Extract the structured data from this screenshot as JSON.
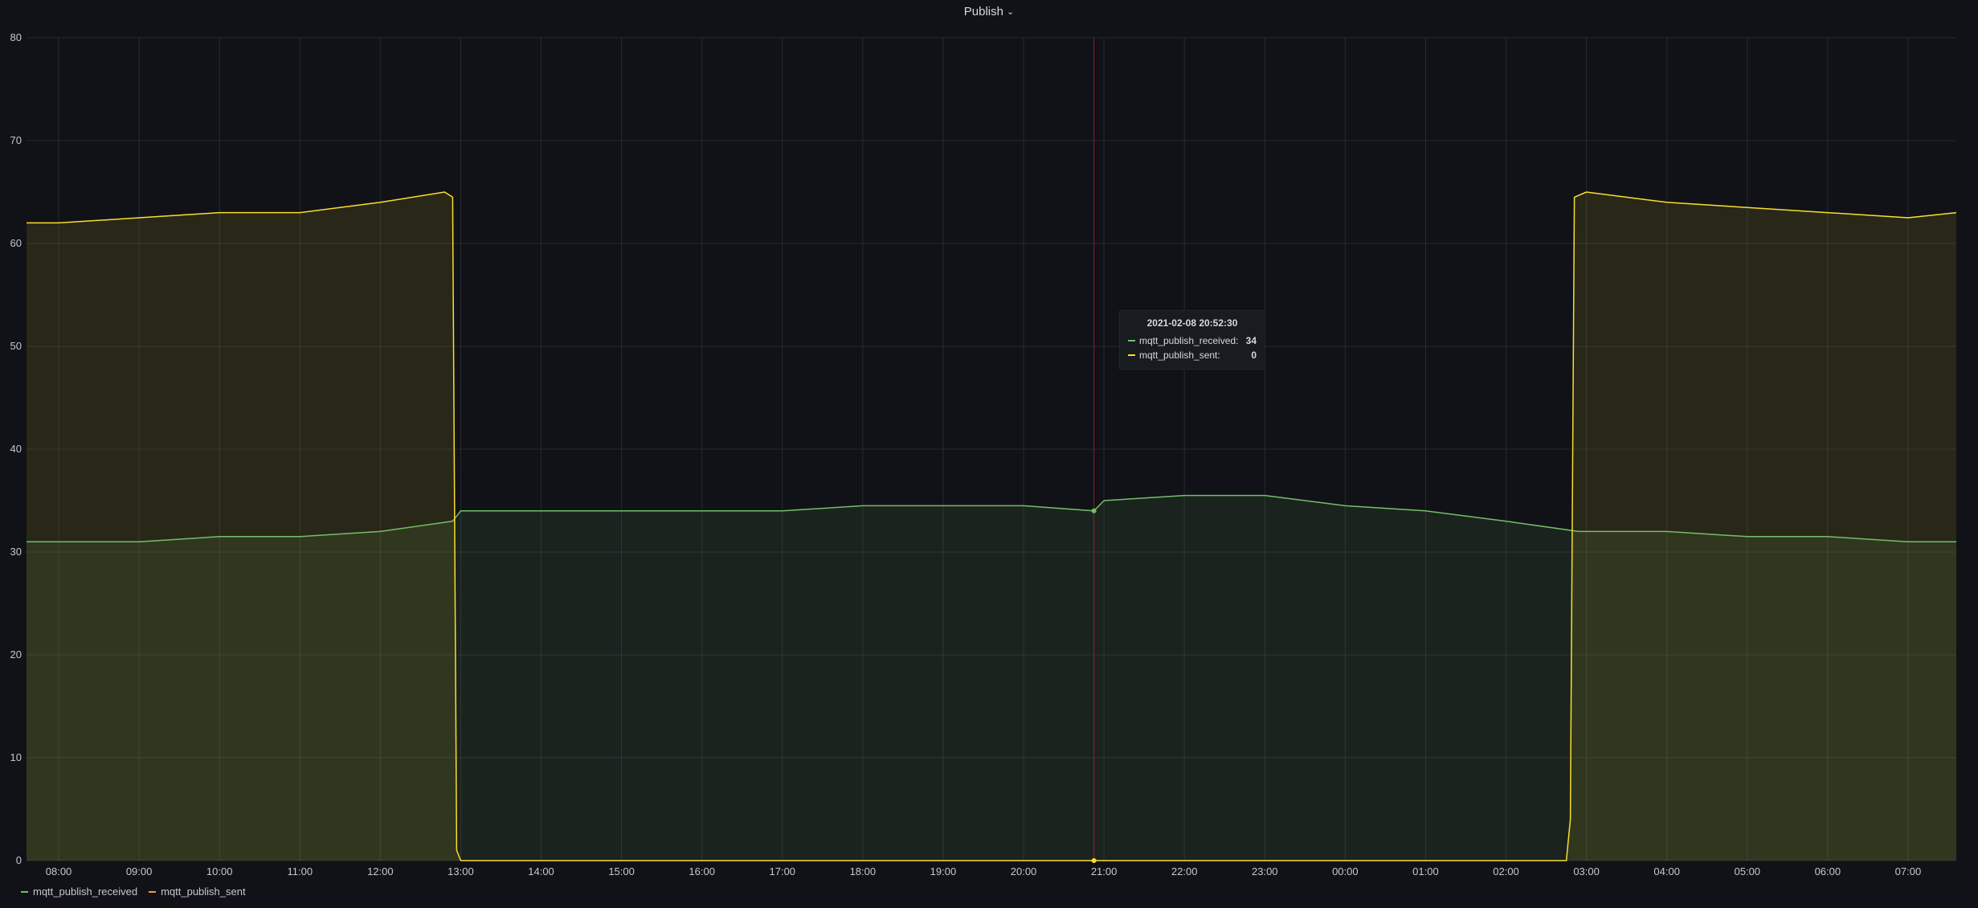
{
  "panel": {
    "title": "Publish"
  },
  "tooltip": {
    "time": "2021-02-08 20:52:30",
    "rows": [
      {
        "name": "mqtt_publish_received:",
        "value": "34",
        "color": "#73bf69"
      },
      {
        "name": "mqtt_publish_sent:",
        "value": "0",
        "color": "#fade2a"
      }
    ]
  },
  "legend": [
    {
      "name": "mqtt_publish_received",
      "color": "#73bf69"
    },
    {
      "name": "mqtt_publish_sent",
      "color": "#ff9830"
    }
  ],
  "chart_data": {
    "type": "area",
    "title": "Publish",
    "xlabel": "",
    "ylabel": "",
    "x_start": "2021-02-08 07:37",
    "x_end": "2021-02-09 07:37",
    "xlim_hours": [
      7.6,
      31.6
    ],
    "ylim": [
      0,
      80
    ],
    "y_ticks": [
      0,
      10,
      20,
      30,
      40,
      50,
      60,
      70,
      80
    ],
    "x_ticks": [
      "08:00",
      "09:00",
      "10:00",
      "11:00",
      "12:00",
      "13:00",
      "14:00",
      "15:00",
      "16:00",
      "17:00",
      "18:00",
      "19:00",
      "20:00",
      "21:00",
      "22:00",
      "23:00",
      "00:00",
      "01:00",
      "02:00",
      "03:00",
      "04:00",
      "05:00",
      "06:00",
      "07:00"
    ],
    "grid": true,
    "legend_position": "bottom-left",
    "cursor_time": "20:52:30",
    "series": [
      {
        "name": "mqtt_publish_received",
        "color": "#73bf69",
        "time_hours": [
          7.6,
          8.0,
          9.0,
          10.0,
          11.0,
          12.0,
          12.9,
          13.0,
          14.0,
          15.0,
          16.0,
          17.0,
          18.0,
          19.0,
          20.0,
          20.875,
          21.0,
          22.0,
          23.0,
          24.0,
          25.0,
          26.0,
          26.9,
          27.0,
          28.0,
          29.0,
          30.0,
          31.0,
          31.6
        ],
        "values": [
          31,
          31,
          31,
          31.5,
          31.5,
          32,
          33,
          34,
          34,
          34,
          34,
          34,
          34.5,
          34.5,
          34.5,
          34,
          35,
          35.5,
          35.5,
          34.5,
          34,
          33,
          32,
          32,
          32,
          31.5,
          31.5,
          31,
          31
        ]
      },
      {
        "name": "mqtt_publish_sent",
        "color": "#fade2a",
        "time_hours": [
          7.6,
          8.0,
          9.0,
          10.0,
          11.0,
          12.0,
          12.8,
          12.9,
          12.95,
          13.0,
          14.0,
          16.0,
          18.0,
          20.0,
          20.875,
          22.0,
          24.0,
          26.0,
          26.75,
          26.8,
          26.85,
          27.0,
          28.0,
          29.0,
          30.0,
          31.0,
          31.6
        ],
        "values": [
          62,
          62,
          62.5,
          63,
          63,
          64,
          65,
          64.5,
          1,
          0,
          0,
          0,
          0,
          0,
          0,
          0,
          0,
          0,
          0,
          4,
          64.5,
          65,
          64,
          63.5,
          63,
          62.5,
          63
        ]
      }
    ]
  }
}
